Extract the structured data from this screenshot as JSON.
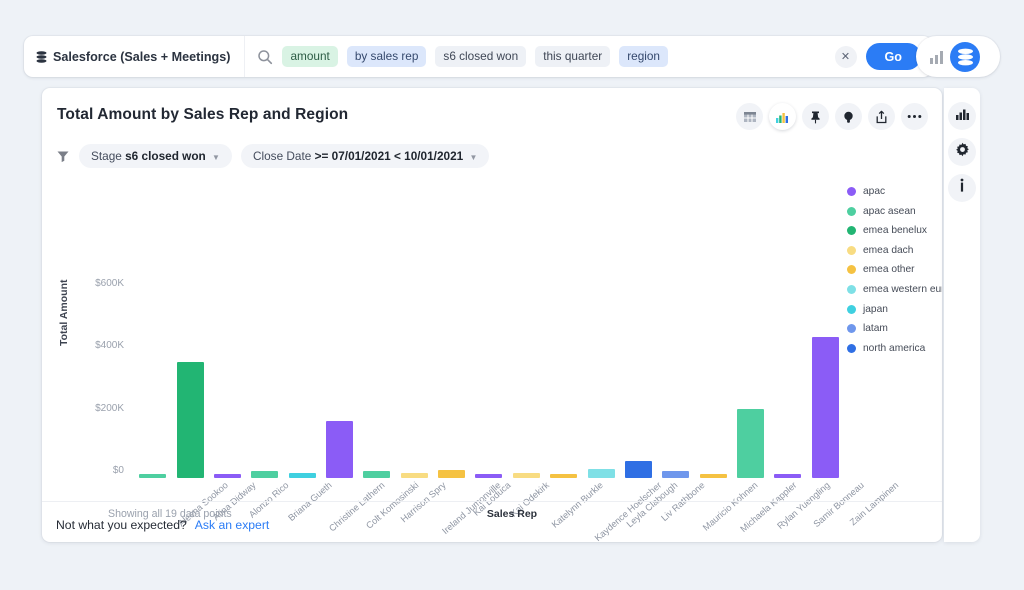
{
  "topbar": {
    "datasource": "Salesforce (Sales + Meetings)",
    "datasource_icon": "stack-icon",
    "search_icon": "search-icon",
    "tokens": [
      {
        "text": "amount",
        "style": "green"
      },
      {
        "text": "by sales rep",
        "style": "blue"
      },
      {
        "text": "s6 closed won",
        "style": "grey"
      },
      {
        "text": "this quarter",
        "style": "grey"
      },
      {
        "text": "region",
        "style": "blue"
      }
    ],
    "clear_label": "✕",
    "go_label": "Go",
    "right_icons": [
      "bar-chart-icon",
      "data-stack-icon"
    ],
    "go_color": "#2b7cf5"
  },
  "card": {
    "title": "Total Amount by Sales Rep and Region",
    "tools": [
      "table-icon",
      "bar-chart-icon",
      "pin-icon",
      "lightbulb-icon",
      "share-icon",
      "more-icon"
    ],
    "active_tool": "bar-chart-icon",
    "filter_icon": "funnel-icon",
    "filters": [
      {
        "label": "Stage",
        "value": "s6 closed won"
      },
      {
        "label": "Close Date",
        "value": ">= 07/01/2021 < 10/01/2021"
      }
    ],
    "showing": "Showing all 19 data points",
    "footer_question": "Not what you expected?",
    "footer_link": "Ask an expert"
  },
  "rail": {
    "icons": [
      "bar-chart-icon",
      "gear-icon",
      "info-icon"
    ]
  },
  "chart_data": {
    "type": "bar",
    "title": "Total Amount by Sales Rep and Region",
    "xlabel": "Sales Rep",
    "ylabel": "Total Amount",
    "ylim": [
      0,
      600000
    ],
    "yticks": [
      0,
      200000,
      400000,
      600000
    ],
    "ytick_labels": [
      "$0",
      "$200K",
      "$400K",
      "$600K"
    ],
    "grid": false,
    "legend_position": "right",
    "legend": [
      {
        "name": "apac",
        "color": "#8b5cf6"
      },
      {
        "name": "apac asean",
        "color": "#4ecfa0"
      },
      {
        "name": "emea benelux",
        "color": "#22b573"
      },
      {
        "name": "emea dach",
        "color": "#f8dc82"
      },
      {
        "name": "emea other",
        "color": "#f5c242"
      },
      {
        "name": "emea western europe",
        "color": "#7fe0e6"
      },
      {
        "name": "japan",
        "color": "#3fd0e0"
      },
      {
        "name": "latam",
        "color": "#6f97ec"
      },
      {
        "name": "north america",
        "color": "#2f6fe4"
      }
    ],
    "categories": [
      "Aleena Sookoo",
      "Alina Didway",
      "Alonzo Rico",
      "Briana Gueth",
      "Christine Lathern",
      "Colt Komosinski",
      "Harrison Spry",
      "Ireland Jumonville",
      "Kai Loduca",
      "Kai Odekirk",
      "Katelynn Burkle",
      "Kaydence Hoelscher",
      "Leyla Clabough",
      "Liv Rathbone",
      "Mauricio Kohnen",
      "Michaela Kappler",
      "Rylan Yuengling",
      "Samir Bonneau",
      "Zain Lampinen"
    ],
    "values": [
      9000,
      371000,
      14000,
      22000,
      16000,
      182000,
      22000,
      15000,
      27000,
      14000,
      17000,
      10000,
      28000,
      53000,
      24000,
      9000,
      221000,
      13000,
      454000
    ],
    "point_regions": [
      "apac asean",
      "emea benelux",
      "apac",
      "apac asean",
      "japan",
      "apac",
      "apac asean",
      "emea dach",
      "emea other",
      "apac",
      "emea dach",
      "emea other",
      "emea western europe",
      "north america",
      "latam",
      "emea other",
      "apac asean",
      "apac",
      "apac"
    ],
    "point_colors": [
      "#4ecfa0",
      "#22b573",
      "#8b5cf6",
      "#4ecfa0",
      "#3fd0e0",
      "#8b5cf6",
      "#4ecfa0",
      "#f8dc82",
      "#f5c242",
      "#8b5cf6",
      "#f8dc82",
      "#f5c242",
      "#7fe0e6",
      "#2f6fe4",
      "#6f97ec",
      "#f5c242",
      "#4ecfa0",
      "#8b5cf6",
      "#8b5cf6"
    ]
  }
}
